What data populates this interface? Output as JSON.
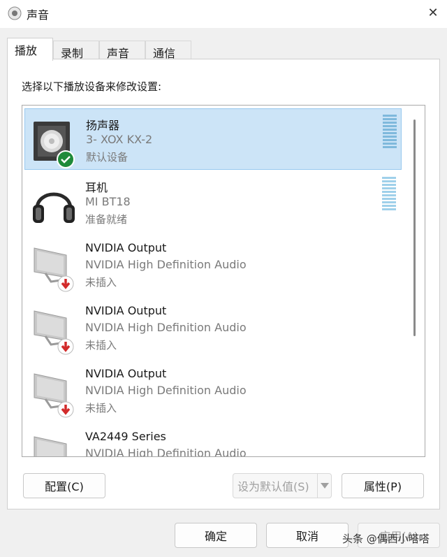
{
  "window": {
    "title": "声音",
    "close_label": "✕"
  },
  "tabs": [
    {
      "label": "播放",
      "active": true
    },
    {
      "label": "录制",
      "active": false
    },
    {
      "label": "声音",
      "active": false
    },
    {
      "label": "通信",
      "active": false
    }
  ],
  "instruction": "选择以下播放设备来修改设置:",
  "devices": [
    {
      "name": "扬声器",
      "sub": "3- XOX KX-2",
      "status": "默认设备",
      "icon": "speaker-icon",
      "badge": "default-check-icon",
      "selected": true
    },
    {
      "name": "耳机",
      "sub": "MI BT18",
      "status": "准备就绪",
      "icon": "headphones-icon",
      "badge": "",
      "selected": false
    },
    {
      "name": "NVIDIA Output",
      "sub": "NVIDIA High Definition Audio",
      "status": "未插入",
      "icon": "monitor-icon",
      "badge": "unplugged-icon",
      "selected": false
    },
    {
      "name": "NVIDIA Output",
      "sub": "NVIDIA High Definition Audio",
      "status": "未插入",
      "icon": "monitor-icon",
      "badge": "unplugged-icon",
      "selected": false
    },
    {
      "name": "NVIDIA Output",
      "sub": "NVIDIA High Definition Audio",
      "status": "未插入",
      "icon": "monitor-icon",
      "badge": "unplugged-icon",
      "selected": false
    },
    {
      "name": "VA2449 Series",
      "sub": "NVIDIA High Definition Audio",
      "status": "",
      "icon": "monitor-icon",
      "badge": "",
      "selected": false
    }
  ],
  "buttons": {
    "configure": "配置(C)",
    "set_default": "设为默认值(S)",
    "properties": "属性(P)",
    "ok": "确定",
    "cancel": "取消",
    "apply": "应用(A)"
  },
  "watermark": "头条 @偶西小嗒嗒",
  "colors": {
    "selected_bg": "#cce4f7",
    "selected_border": "#99c9ef",
    "check_green": "#1f8a3a",
    "unplug_red": "#d22b2b"
  }
}
